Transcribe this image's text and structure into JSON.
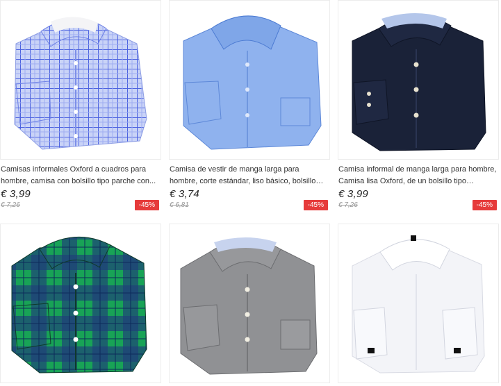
{
  "products": [
    {
      "title": "Camisas informales Oxford a cuadros para hombre, camisa con bolsillo tipo parche con...",
      "price": "€ 3,99",
      "old_price": "€ 7,26",
      "discount": "-45%",
      "shirt_color": "#c2cdf5",
      "pattern": "check",
      "image_icon": "shirt-image"
    },
    {
      "title": "Camisa de vestir de manga larga para hombre, corte estándar, liso básico, bolsillo tipo parch...",
      "price": "€ 3,74",
      "old_price": "€ 6,81",
      "discount": "-45%",
      "shirt_color": "#7fa6e8",
      "pattern": "solid",
      "image_icon": "shirt-image"
    },
    {
      "title": "Camisa informal de manga larga para hombre, Camisa lisa Oxford, de un bolsillo tipo parche,...",
      "price": "€ 3,99",
      "old_price": "€ 7,26",
      "discount": "-45%",
      "shirt_color": "#1a2238",
      "pattern": "solid",
      "image_icon": "shirt-image"
    },
    {
      "title": "",
      "price": "",
      "old_price": "",
      "discount": "",
      "shirt_color": "#1a9a52",
      "pattern": "plaid",
      "image_icon": "shirt-image"
    },
    {
      "title": "",
      "price": "",
      "old_price": "",
      "discount": "",
      "shirt_color": "#8e8f92",
      "pattern": "solid",
      "image_icon": "shirt-image"
    },
    {
      "title": "",
      "price": "",
      "old_price": "",
      "discount": "",
      "shirt_color": "#f3f4f8",
      "pattern": "solid",
      "image_icon": "shirt-image"
    }
  ]
}
